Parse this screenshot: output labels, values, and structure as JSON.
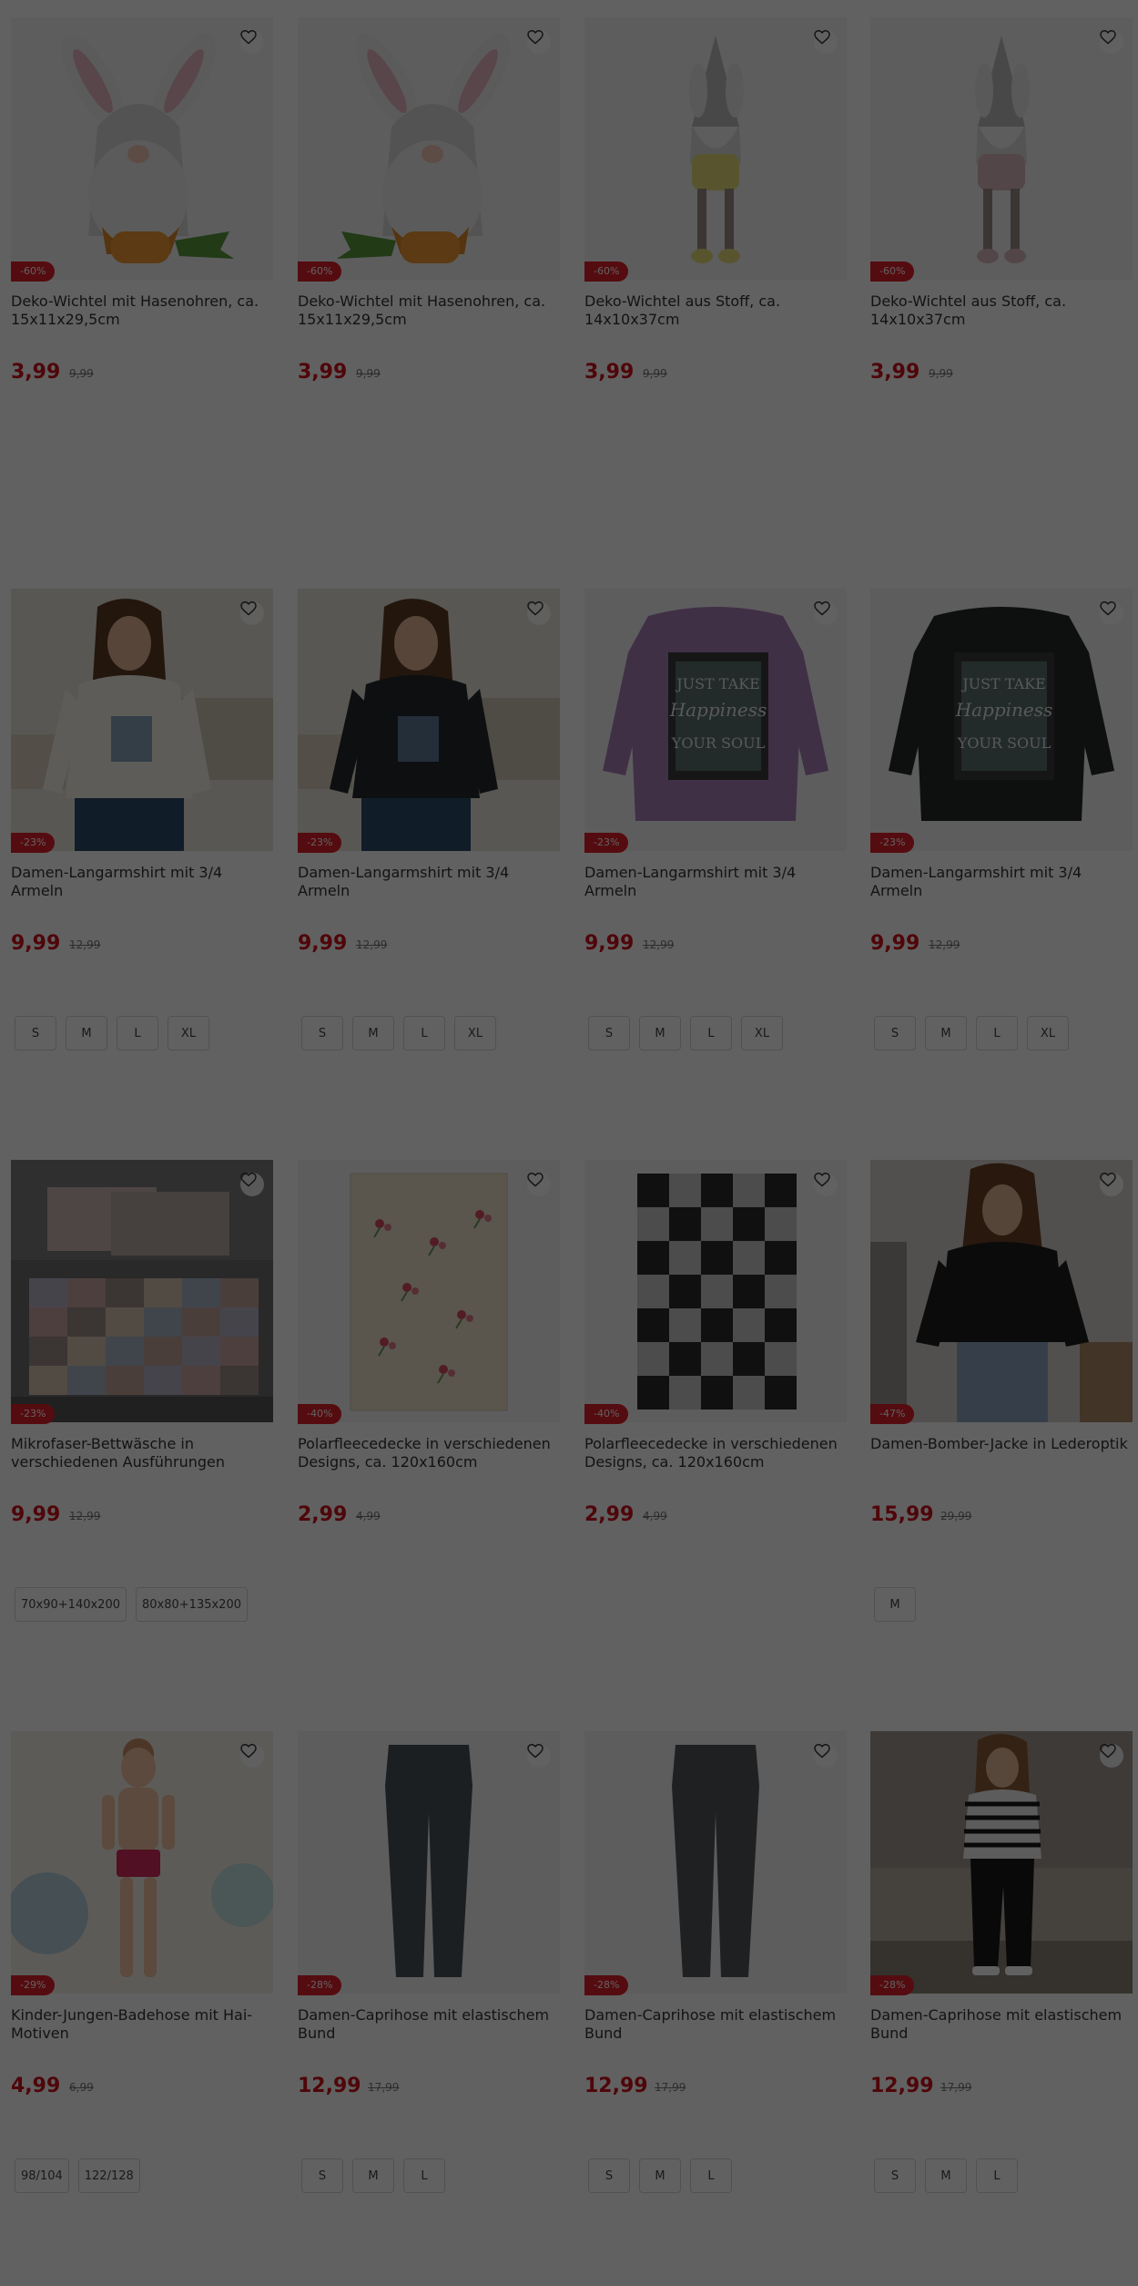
{
  "products": [
    [
      {
        "name": "Deko-Wichtel mit Hasenohren, ca. 15x11x29,5cm",
        "price": "3,99",
        "old_price": "9,99",
        "discount": "-60%",
        "sizes": [],
        "image": "gnome-bunny-carrot-right"
      },
      {
        "name": "Deko-Wichtel mit Hasenohren, ca. 15x11x29,5cm",
        "price": "3,99",
        "old_price": "9,99",
        "discount": "-60%",
        "sizes": [],
        "image": "gnome-bunny-carrot-left"
      },
      {
        "name": "Deko-Wichtel aus Stoff, ca. 14x10x37cm",
        "price": "3,99",
        "old_price": "9,99",
        "discount": "-60%",
        "sizes": [],
        "image": "gnome-fabric-yellow"
      },
      {
        "name": "Deko-Wichtel aus Stoff, ca. 14x10x37cm",
        "price": "3,99",
        "old_price": "9,99",
        "discount": "-60%",
        "sizes": [],
        "image": "gnome-fabric-pink"
      }
    ],
    [
      {
        "name": "Damen-Langarmshirt mit 3/4 Armeln",
        "price": "9,99",
        "old_price": "12,99",
        "discount": "-23%",
        "sizes": [
          "S",
          "M",
          "L",
          "XL"
        ],
        "image": "woman-white-shirt"
      },
      {
        "name": "Damen-Langarmshirt mit 3/4 Armeln",
        "price": "9,99",
        "old_price": "12,99",
        "discount": "-23%",
        "sizes": [
          "S",
          "M",
          "L",
          "XL"
        ],
        "image": "woman-black-shirt"
      },
      {
        "name": "Damen-Langarmshirt mit 3/4 Armeln",
        "price": "9,99",
        "old_price": "12,99",
        "discount": "-23%",
        "sizes": [
          "S",
          "M",
          "L",
          "XL"
        ],
        "image": "purple-shirt"
      },
      {
        "name": "Damen-Langarmshirt mit 3/4 Armeln",
        "price": "9,99",
        "old_price": "12,99",
        "discount": "-23%",
        "sizes": [
          "S",
          "M",
          "L",
          "XL"
        ],
        "image": "dark-shirt"
      }
    ],
    [
      {
        "name": "Mikrofaser-Bettwäsche in verschiedenen Ausführungen",
        "price": "9,99",
        "old_price": "12,99",
        "discount": "-23%",
        "sizes": [
          "70x90+140x200",
          "80x80+135x200"
        ],
        "image": "bedding-patchwork"
      },
      {
        "name": "Polarfleecedecke in verschiedenen Designs, ca. 120x160cm",
        "price": "2,99",
        "old_price": "4,99",
        "discount": "-40%",
        "sizes": [],
        "image": "fleece-flowers"
      },
      {
        "name": "Polarfleecedecke in verschiedenen Designs, ca. 120x160cm",
        "price": "2,99",
        "old_price": "4,99",
        "discount": "-40%",
        "sizes": [],
        "image": "fleece-checkered"
      },
      {
        "name": "Damen-Bomber-Jacke in Lederoptik",
        "price": "15,99",
        "old_price": "29,99",
        "discount": "-47%",
        "sizes": [
          "M"
        ],
        "image": "woman-bomber-jacket"
      }
    ],
    [
      {
        "name": "Kinder-Jungen-Badehose mit Hai-Motiven",
        "price": "4,99",
        "old_price": "6,99",
        "discount": "-29%",
        "sizes": [
          "98/104",
          "122/128"
        ],
        "image": "boy-swim-shorts"
      },
      {
        "name": "Damen-Caprihose mit elastischem Bund",
        "price": "12,99",
        "old_price": "17,99",
        "discount": "-28%",
        "sizes": [
          "S",
          "M",
          "L"
        ],
        "image": "grey-capri-pants"
      },
      {
        "name": "Damen-Caprihose mit elastischem Bund",
        "price": "12,99",
        "old_price": "17,99",
        "discount": "-28%",
        "sizes": [
          "S",
          "M",
          "L"
        ],
        "image": "grey-capri-pants-2"
      },
      {
        "name": "Damen-Caprihose mit elastischem Bund",
        "price": "12,99",
        "old_price": "17,99",
        "discount": "-28%",
        "sizes": [
          "S",
          "M",
          "L"
        ],
        "image": "woman-black-capri"
      }
    ]
  ],
  "colors": {
    "price": "#d0121b",
    "badge": "#e0202a",
    "overlay": "rgba(0,0,0,0.62)"
  }
}
